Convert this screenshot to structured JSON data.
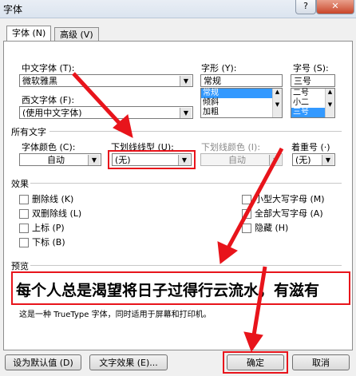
{
  "window": {
    "title": "字体",
    "help_label": "?",
    "close_label": "✕"
  },
  "tabs": [
    {
      "label": "字体 (N)"
    },
    {
      "label": "高级 (V)"
    }
  ],
  "font": {
    "chinese_label": "中文字体 (T):",
    "chinese_value": "微软雅黑",
    "western_label": "西文字体 (F):",
    "western_value": "(使用中文字体)",
    "style_label": "字形 (Y):",
    "style_value": "常规",
    "style_options": [
      "常规",
      "倾斜",
      "加粗"
    ],
    "size_label": "字号 (S):",
    "size_value": "三号",
    "size_options": [
      "二号",
      "小二",
      "三号"
    ]
  },
  "all_text": {
    "section_label": "所有文字",
    "color_label": "字体颜色 (C):",
    "color_value": "自动",
    "underline_label": "下划线线型 (U):",
    "underline_value": "(无)",
    "underline_color_label": "下划线颜色 (I):",
    "underline_color_value": "自动",
    "emphasis_label": "着重号 (·)",
    "emphasis_value": "(无)"
  },
  "effects": {
    "section_label": "效果",
    "left": [
      "删除线 (K)",
      "双删除线 (L)",
      "上标 (P)",
      "下标 (B)"
    ],
    "right": [
      "小型大写字母 (M)",
      "全部大写字母 (A)",
      "隐藏 (H)"
    ]
  },
  "preview": {
    "section_label": "预览",
    "text": "每个人总是渴望将日子过得行云流水，有滋有",
    "note": "这是一种 TrueType 字体，同时适用于屏幕和打印机。"
  },
  "buttons": {
    "default": "设为默认值 (D)",
    "effects": "文字效果 (E)...",
    "ok": "确定",
    "cancel": "取消"
  },
  "colors": {
    "annotation_red": "#e8141b",
    "selection_blue": "#3399ff"
  }
}
